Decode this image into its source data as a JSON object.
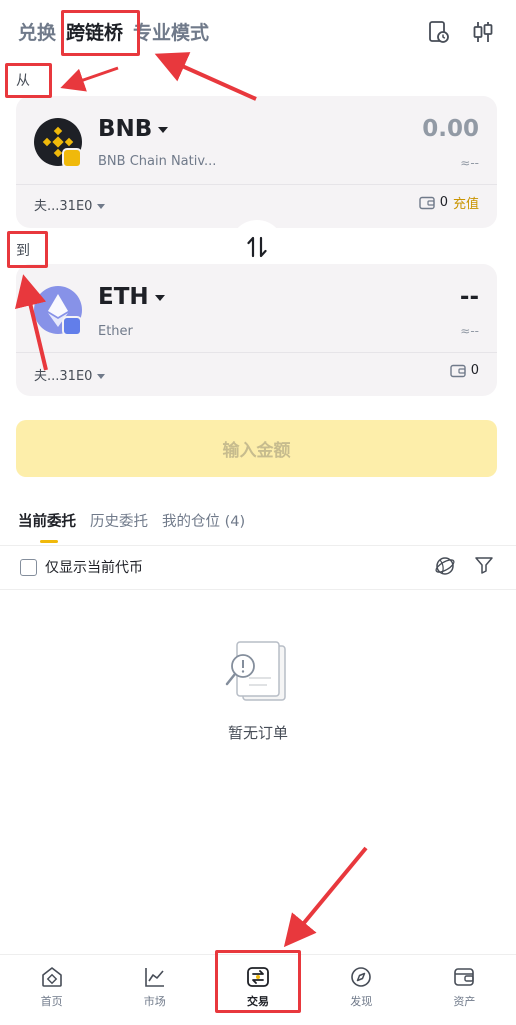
{
  "tabs": [
    "兑换",
    "跨链桥",
    "专业模式"
  ],
  "from_label": "从",
  "to_label": "到",
  "from": {
    "symbol": "BNB",
    "name": "BNB Chain Nativ...",
    "amount": "0.00",
    "fiat": "≈--",
    "address": "夫...31E0",
    "balance": "0",
    "deposit_label": "充值"
  },
  "to": {
    "symbol": "ETH",
    "name": "Ether",
    "amount": "--",
    "fiat": "≈--",
    "address": "夫...31E0",
    "balance": "0"
  },
  "cta_label": "输入金额",
  "order_tabs": [
    "当前委托",
    "历史委托",
    "我的仓位 (4)"
  ],
  "filter_label": "仅显示当前代币",
  "empty_text": "暂无订单",
  "nav": [
    "首页",
    "市场",
    "交易",
    "发现",
    "资产"
  ],
  "colors": {
    "accent": "#f0b90b",
    "annotation": "#e8383d",
    "cta_bg": "#fdeeaa",
    "card_bg": "#f5f3f5"
  }
}
